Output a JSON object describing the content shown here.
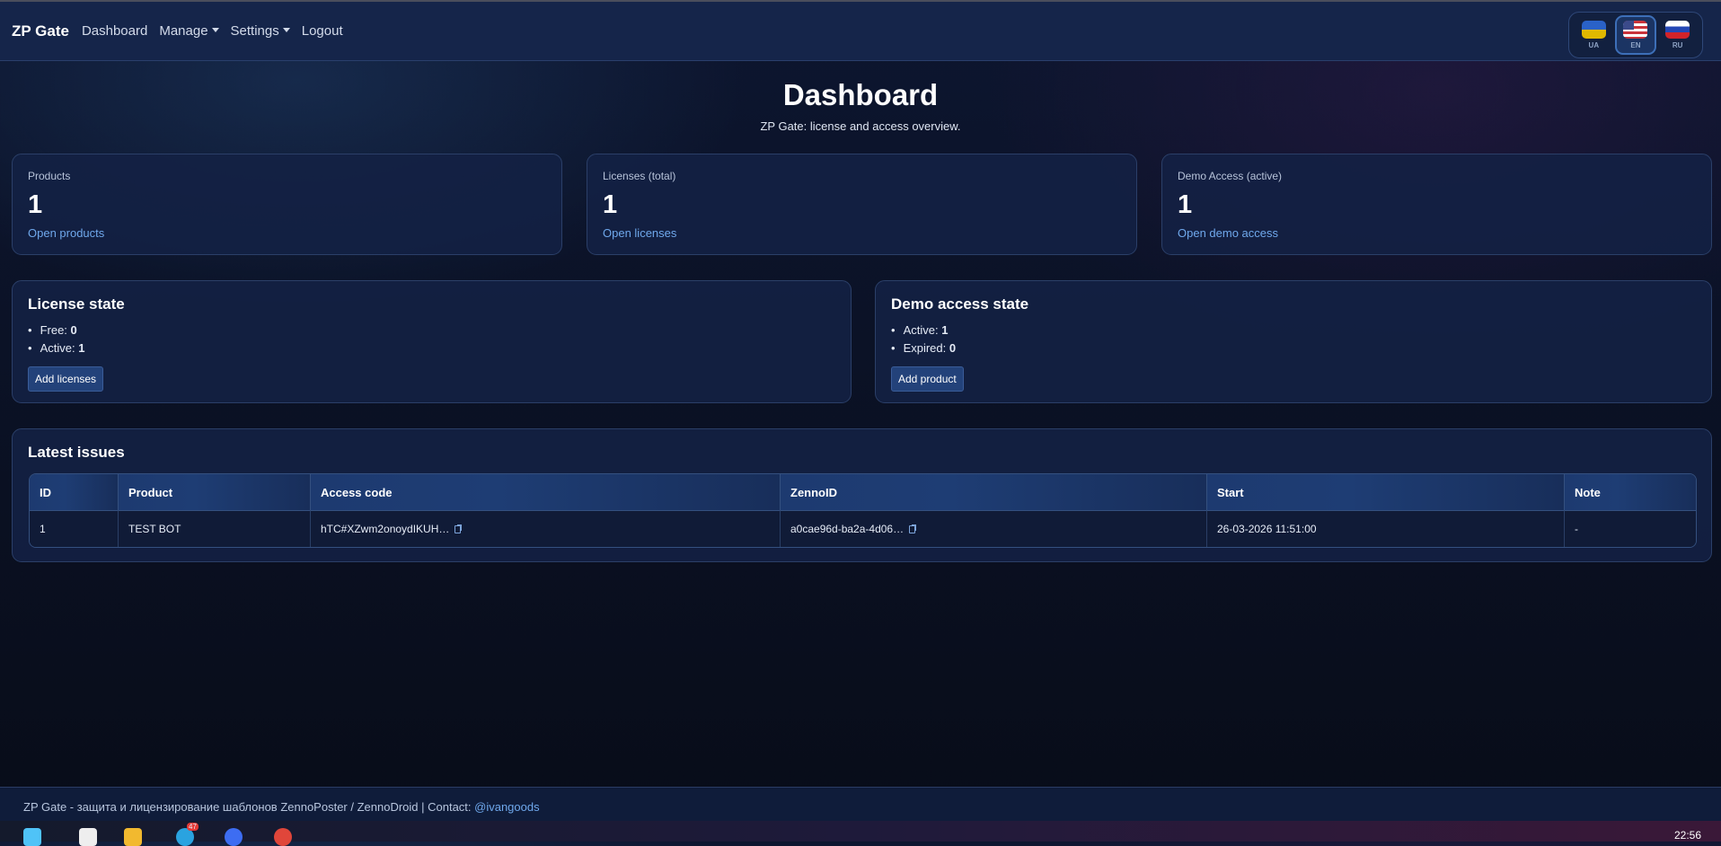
{
  "nav": {
    "brand": "ZP Gate",
    "links": [
      "Dashboard",
      "Manage",
      "Settings",
      "Logout"
    ],
    "langs": [
      "UA",
      "EN",
      "RU"
    ],
    "active_lang": "EN"
  },
  "header": {
    "title": "Dashboard",
    "subtitle": "ZP Gate: license and access overview."
  },
  "stats": [
    {
      "label": "Products",
      "value": "1",
      "link": "Open products"
    },
    {
      "label": "Licenses (total)",
      "value": "1",
      "link": "Open licenses"
    },
    {
      "label": "Demo Access (active)",
      "value": "1",
      "link": "Open demo access"
    }
  ],
  "license_state": {
    "title": "License state",
    "items": [
      {
        "k": "Free:",
        "v": "0"
      },
      {
        "k": "Active:",
        "v": "1"
      }
    ],
    "button": "Add licenses"
  },
  "demo_state": {
    "title": "Demo access state",
    "items": [
      {
        "k": "Active:",
        "v": "1"
      },
      {
        "k": "Expired:",
        "v": "0"
      }
    ],
    "button": "Add product"
  },
  "issues": {
    "title": "Latest issues",
    "columns": [
      "ID",
      "Product",
      "Access code",
      "ZennoID",
      "Start",
      "Note"
    ],
    "rows": [
      {
        "id": "1",
        "product": "TEST BOT",
        "access_code": "hTC#XZwm2onoydIKUH…",
        "zenno_id": "a0cae96d-ba2a-4d06…",
        "start": "26-03-2026 11:51:00",
        "note": "-"
      }
    ]
  },
  "footer": {
    "text": "ZP Gate - защита и лицензирование шаблонов ZennoPoster / ZennoDroid | Contact: ",
    "contact": "@ivangoods"
  },
  "taskbar": {
    "time": "22:56",
    "badge": "47"
  }
}
